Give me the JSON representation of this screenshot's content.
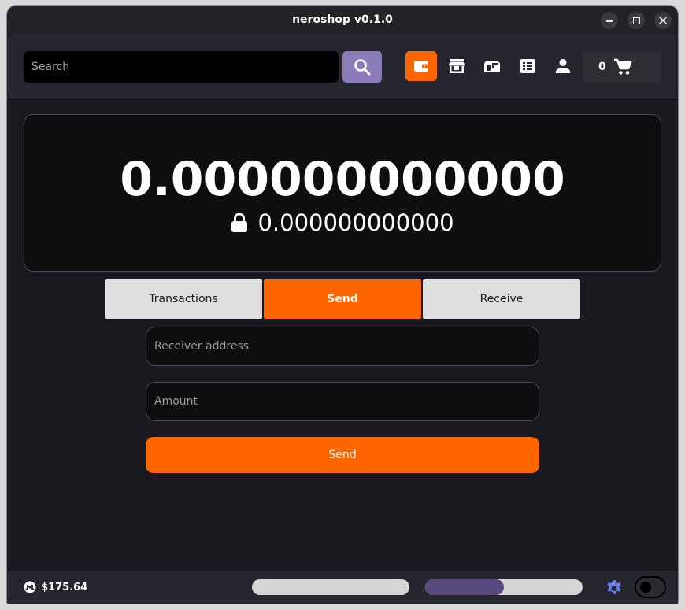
{
  "window": {
    "title": "neroshop v0.1.0",
    "controls": [
      "minimize-icon",
      "maximize-icon",
      "close-icon"
    ]
  },
  "toolbar": {
    "search": {
      "placeholder": "Search",
      "value": ""
    },
    "search_button_icon": "search-icon",
    "nav": [
      {
        "name": "wallet",
        "icon": "wallet-icon",
        "active": true
      },
      {
        "name": "store",
        "icon": "store-icon",
        "active": false
      },
      {
        "name": "mailbox",
        "icon": "mailbox-icon",
        "active": false
      },
      {
        "name": "orders",
        "icon": "receipt-icon",
        "active": false
      },
      {
        "name": "account",
        "icon": "user-icon",
        "active": false
      }
    ],
    "cart": {
      "count": "0",
      "icon": "cart-icon"
    }
  },
  "wallet": {
    "balance": "0.000000000000",
    "locked_balance": "0.000000000000",
    "locked_icon": "lock-icon"
  },
  "tabs": [
    {
      "label": "Transactions",
      "active": false
    },
    {
      "label": "Send",
      "active": true
    },
    {
      "label": "Receive",
      "active": false
    }
  ],
  "send_form": {
    "receiver_placeholder": "Receiver address",
    "amount_placeholder": "Amount",
    "submit_label": "Send"
  },
  "status": {
    "currency_icon": "monero-icon",
    "price": "$175.64",
    "progress_1": 0,
    "progress_2": 0.5,
    "settings_icon": "gear-icon",
    "theme_toggle_on": false
  },
  "colors": {
    "accent": "#ff6600",
    "secondary": "#8c7cb9",
    "progress_fill": "#584a7e",
    "background": "#1a191f",
    "toolbar": "#26262f",
    "card": "#0e0e10"
  }
}
